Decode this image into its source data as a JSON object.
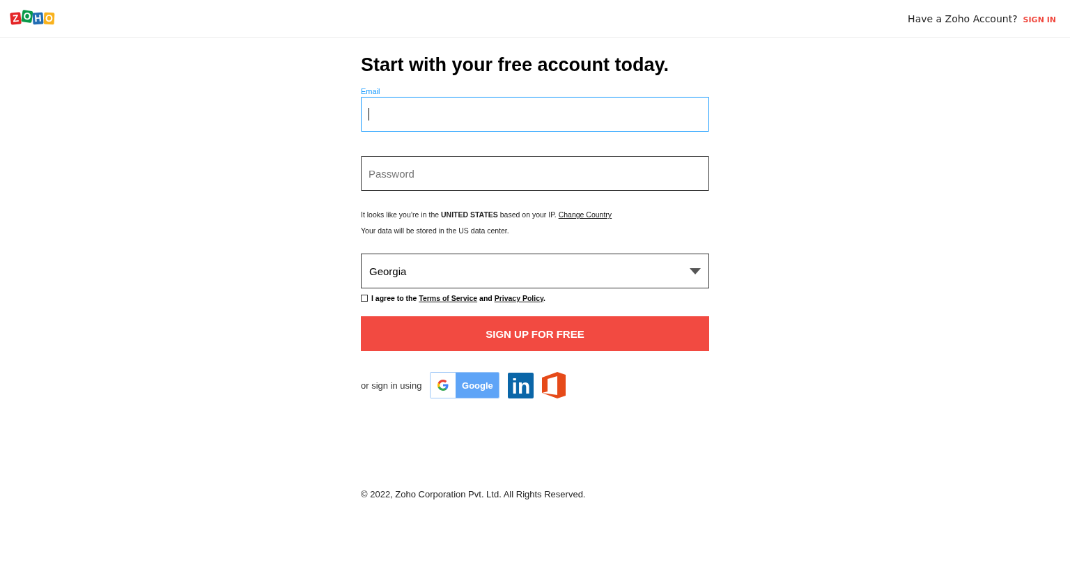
{
  "header": {
    "logo_letters": [
      {
        "letter": "Z",
        "color": "#e42527"
      },
      {
        "letter": "O",
        "color": "#089949"
      },
      {
        "letter": "H",
        "color": "#226db4"
      },
      {
        "letter": "O",
        "color": "#f9b21d"
      }
    ],
    "account_prompt": "Have a Zoho Account?",
    "sign_in": "SIGN IN"
  },
  "form": {
    "title": "Start with your free account today.",
    "email": {
      "label": "Email",
      "focused": true
    },
    "password": {
      "placeholder": "Password",
      "focused": false
    },
    "location_note": {
      "text": "It looks like you’re in the **UNITED STATES** based on your IP.",
      "link": "Change Country"
    },
    "data_note": "Your data will be stored in the US data center.",
    "region_select": {
      "value": "Georgia"
    },
    "agreement": {
      "checked": false,
      "prefix": "I agree to the",
      "terms": "Terms of Service",
      "conjunction": "and",
      "privacy": "Privacy Policy",
      "suffix": "."
    },
    "submit": "SIGN UP FOR FREE",
    "social": {
      "label": "or sign in using",
      "google": "Google",
      "linkedin": "in"
    }
  },
  "footer": "© 2022, Zoho Corporation Pvt. Ltd. All Rights Reserved."
}
